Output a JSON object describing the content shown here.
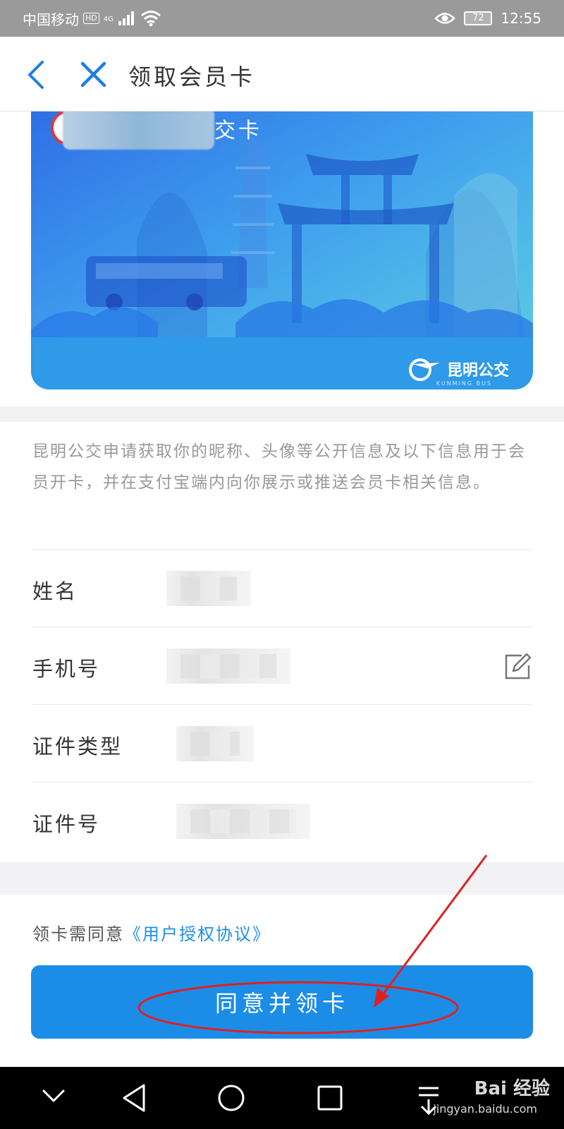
{
  "status_bar": {
    "carrier": "中国移动",
    "hd": "HD",
    "network": "4G",
    "battery": "72",
    "time": "12:55"
  },
  "nav": {
    "title": "领取会员卡",
    "back_icon": "chevron-left-icon",
    "close_icon": "close-icon"
  },
  "card": {
    "title": "交卡",
    "brand": "昆明公交",
    "brand_sub": "KUNMING BUS"
  },
  "notice": "昆明公交申请获取你的昵称、头像等公开信息及以下信息用于会员开卡，并在支付宝端内向你展示或推送会员卡相关信息。",
  "form": {
    "rows": [
      {
        "label": "姓名"
      },
      {
        "label": "手机号"
      },
      {
        "label": "证件类型"
      },
      {
        "label": "证件号"
      }
    ]
  },
  "agreement": {
    "prefix": "领卡需同意",
    "link": "《用户授权协议》"
  },
  "submit_label": "同意并领卡",
  "watermark": {
    "text": "Bai 经验",
    "sub": "jingyan.baidu.com"
  },
  "colors": {
    "accent": "#1c8de6",
    "link": "#1e8fe8",
    "annotation": "#e02020"
  }
}
